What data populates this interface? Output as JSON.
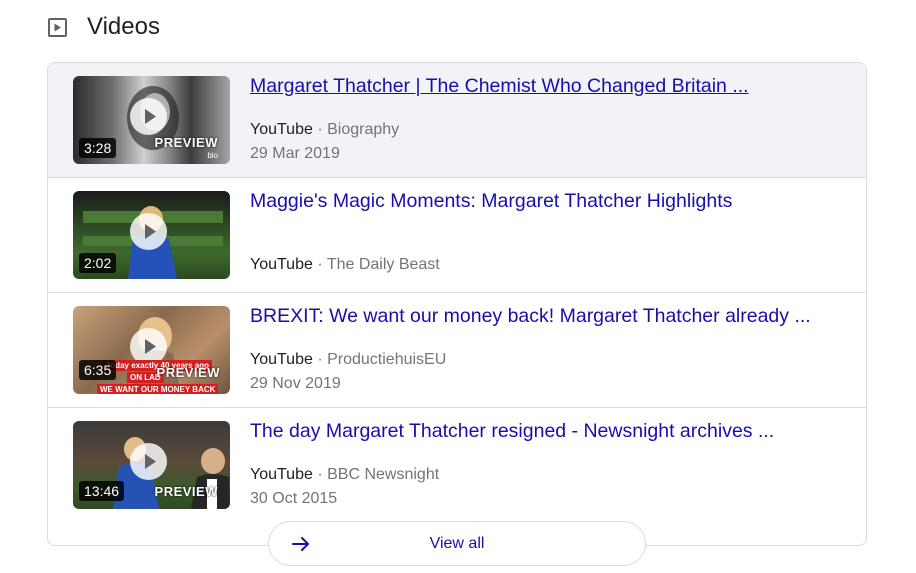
{
  "section": {
    "title": "Videos",
    "icon": "video-play-icon"
  },
  "videos": [
    {
      "title": "Margaret Thatcher | The Chemist Who Changed Britain ...",
      "platform": "YouTube",
      "separator": "·",
      "channel": "Biography",
      "date": "29 Mar 2019",
      "duration": "3:28",
      "preview": "PREVIEW",
      "preview_sub": "bio"
    },
    {
      "title": "Maggie's Magic Moments: Margaret Thatcher Highlights",
      "platform": "YouTube",
      "separator": "·",
      "channel": "The Daily Beast",
      "date": "",
      "duration": "2:02"
    },
    {
      "title": "BREXIT: We want our money back! Margaret Thatcher already ...",
      "platform": "YouTube",
      "separator": "·",
      "channel": "ProductiehuisEU",
      "date": "29 Nov 2019",
      "duration": "6:35",
      "preview": "PREVIEW",
      "overlay_text_1": "Today exactly 40 years ago",
      "overlay_text_2": "ON LAD",
      "overlay_text_3": "WE WANT OUR MONEY BACK"
    },
    {
      "title": "The day Margaret Thatcher resigned - Newsnight archives ...",
      "platform": "YouTube",
      "separator": "·",
      "channel": "BBC Newsnight",
      "date": "30 Oct 2015",
      "duration": "13:46",
      "preview": "PREVIEW"
    }
  ],
  "view_all": {
    "label": "View all",
    "icon": "arrow-right-icon"
  },
  "colors": {
    "link": "#1a0dab",
    "text": "#202124",
    "secondary": "#70757a",
    "border": "#dadce0",
    "hover_row": "#f1f3f7"
  }
}
